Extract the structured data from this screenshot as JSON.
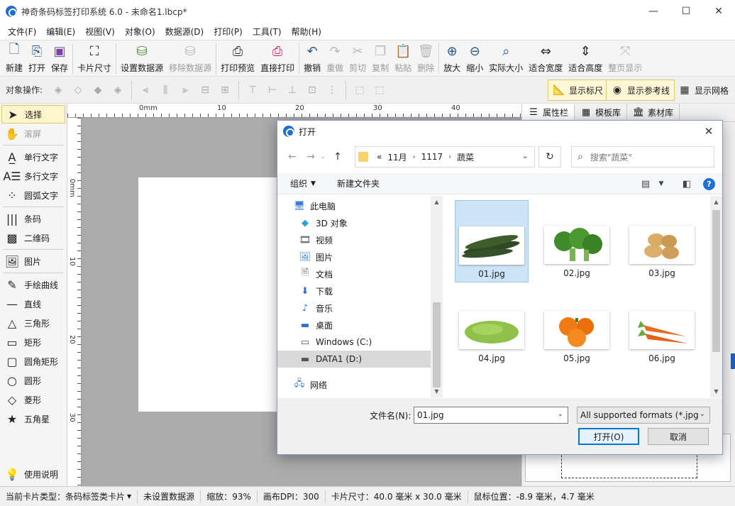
{
  "window": {
    "title": "神奇条码标签打印系统 6.0 - 未命名1.lbcp*",
    "minimize": "—",
    "maximize": "☐",
    "close": "✕"
  },
  "menu": [
    "文件(F)",
    "编辑(E)",
    "视图(V)",
    "对象(O)",
    "数据源(D)",
    "打印(P)",
    "工具(T)",
    "帮助(H)"
  ],
  "toolbar": [
    {
      "label": "新建",
      "icon": "new-file-icon",
      "enabled": true
    },
    {
      "label": "打开",
      "icon": "open-file-icon",
      "enabled": true
    },
    {
      "label": "保存",
      "icon": "save-icon",
      "enabled": true
    },
    {
      "label": "卡片尺寸",
      "icon": "card-size-icon",
      "enabled": true
    },
    {
      "label": "设置数据源",
      "icon": "database-icon",
      "enabled": true
    },
    {
      "label": "移除数据源",
      "icon": "database-remove-icon",
      "enabled": false
    },
    {
      "label": "打印预览",
      "icon": "print-preview-icon",
      "enabled": true
    },
    {
      "label": "直接打印",
      "icon": "printer-icon",
      "enabled": true
    },
    {
      "label": "撤销",
      "icon": "undo-icon",
      "enabled": true
    },
    {
      "label": "重做",
      "icon": "redo-icon",
      "enabled": false
    },
    {
      "label": "剪切",
      "icon": "cut-icon",
      "enabled": false
    },
    {
      "label": "复制",
      "icon": "copy-icon",
      "enabled": false
    },
    {
      "label": "粘贴",
      "icon": "paste-icon",
      "enabled": false
    },
    {
      "label": "删除",
      "icon": "trash-icon",
      "enabled": false
    },
    {
      "label": "放大",
      "icon": "zoom-in-icon",
      "enabled": true
    },
    {
      "label": "缩小",
      "icon": "zoom-out-icon",
      "enabled": true
    },
    {
      "label": "实际大小",
      "icon": "zoom-actual-icon",
      "enabled": true
    },
    {
      "label": "适合宽度",
      "icon": "fit-width-icon",
      "enabled": true
    },
    {
      "label": "适合高度",
      "icon": "fit-height-icon",
      "enabled": true
    },
    {
      "label": "整页显示",
      "icon": "fit-page-icon",
      "enabled": false
    }
  ],
  "objbar": {
    "label": "对象操作:",
    "show_ruler": "显示标尺",
    "show_guides": "显示参考线",
    "show_grid": "显示网格"
  },
  "tools": [
    {
      "label": "选择",
      "icon": "arrow-cursor-icon"
    },
    {
      "label": "滚屏",
      "icon": "hand-icon"
    },
    {
      "label": "单行文字",
      "icon": "single-text-icon"
    },
    {
      "label": "多行文字",
      "icon": "multi-text-icon"
    },
    {
      "label": "圆弧文字",
      "icon": "arc-text-icon"
    },
    {
      "label": "条码",
      "icon": "barcode-icon"
    },
    {
      "label": "二维码",
      "icon": "qrcode-icon"
    },
    {
      "label": "图片",
      "icon": "image-icon"
    },
    {
      "label": "手绘曲线",
      "icon": "pen-icon"
    },
    {
      "label": "直线",
      "icon": "line-icon"
    },
    {
      "label": "三角形",
      "icon": "triangle-icon"
    },
    {
      "label": "矩形",
      "icon": "rectangle-icon"
    },
    {
      "label": "圆角矩形",
      "icon": "rounded-rect-icon"
    },
    {
      "label": "圆形",
      "icon": "circle-icon"
    },
    {
      "label": "菱形",
      "icon": "diamond-icon"
    },
    {
      "label": "五角星",
      "icon": "star-icon"
    },
    {
      "label": "使用说明",
      "icon": "lightbulb-icon"
    }
  ],
  "ruler": {
    "h": [
      "0mm",
      "10",
      "20",
      "30",
      "40"
    ],
    "v": [
      "0mm",
      "10",
      "20",
      "30"
    ]
  },
  "rightpanel": {
    "tabs": [
      "属性栏",
      "模板库",
      "素材库"
    ]
  },
  "status": {
    "card_type": "当前卡片类型：条码标签类卡片",
    "data_source": "未设置数据源",
    "zoom": "缩放：93%",
    "dpi": "画布DPI：300",
    "card_size": "卡片尺寸：40.0 毫米 x 30.0 毫米",
    "mouse": "鼠标位置：-8.9 毫米，4.7 毫米"
  },
  "dialog": {
    "title": "打开",
    "path": [
      "«",
      "11月",
      "1117",
      "蔬菜"
    ],
    "search_placeholder": "搜索\"蔬菜\"",
    "organize": "组织",
    "new_folder": "新建文件夹",
    "tree": [
      {
        "label": "此电脑",
        "icon": "computer-icon"
      },
      {
        "label": "3D 对象",
        "icon": "cube-3d-icon"
      },
      {
        "label": "视频",
        "icon": "video-icon"
      },
      {
        "label": "图片",
        "icon": "picture-icon"
      },
      {
        "label": "文档",
        "icon": "document-icon"
      },
      {
        "label": "下载",
        "icon": "download-icon"
      },
      {
        "label": "音乐",
        "icon": "music-icon"
      },
      {
        "label": "桌面",
        "icon": "desktop-icon"
      },
      {
        "label": "Windows (C:)",
        "icon": "drive-icon"
      },
      {
        "label": "DATA1 (D:)",
        "icon": "drive-icon"
      },
      {
        "label": "网络",
        "icon": "network-icon"
      }
    ],
    "files": [
      {
        "name": "01.jpg",
        "content": "cucumber"
      },
      {
        "name": "02.jpg",
        "content": "broccoli"
      },
      {
        "name": "03.jpg",
        "content": "potato"
      },
      {
        "name": "04.jpg",
        "content": "chayote"
      },
      {
        "name": "05.jpg",
        "content": "pumpkin"
      },
      {
        "name": "06.jpg",
        "content": "carrot"
      }
    ],
    "filename_label": "文件名(N):",
    "filename": "01.jpg",
    "format": "All supported formats (*.jpg",
    "open_btn": "打开(O)",
    "cancel_btn": "取消"
  }
}
